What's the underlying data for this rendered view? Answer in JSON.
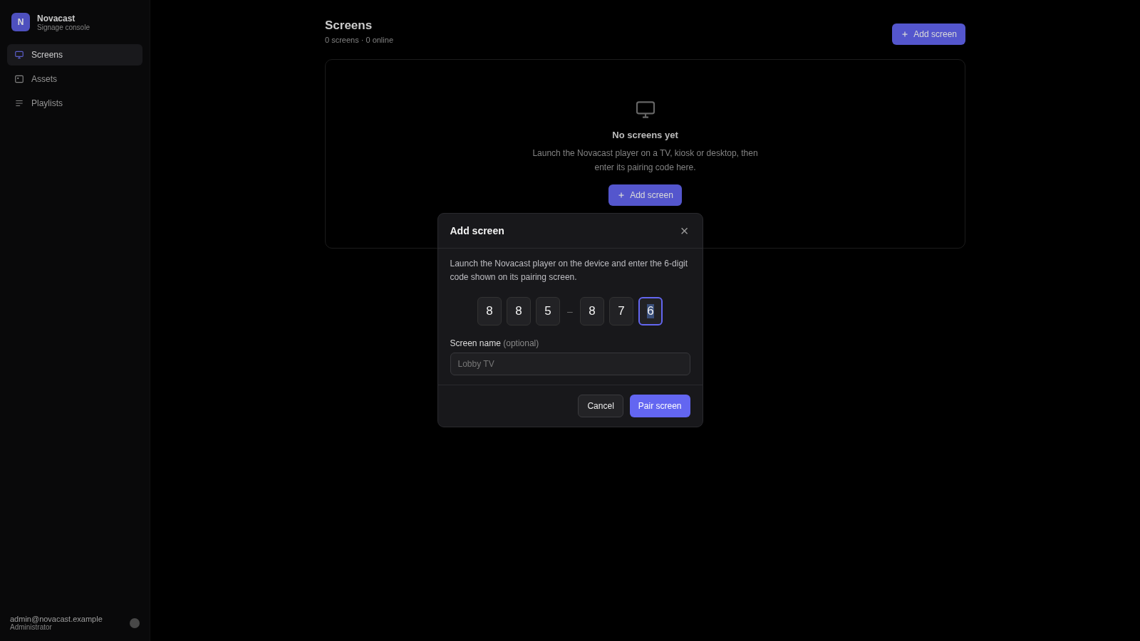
{
  "sidebar": {
    "brand": {
      "initials": "N",
      "name": "Novacast",
      "subtitle": "Signage console"
    },
    "items": [
      {
        "label": "Screens",
        "selected": true
      },
      {
        "label": "Assets",
        "selected": false
      },
      {
        "label": "Playlists",
        "selected": false
      }
    ],
    "footer": {
      "email": "admin@novacast.example",
      "role": "Administrator"
    }
  },
  "page": {
    "title": "Screens",
    "subtitle": "0 screens · 0 online",
    "add_button": "Add screen",
    "empty_state": {
      "title": "No screens yet",
      "description": "Launch the Novacast player on a TV, kiosk or desktop, then enter its pairing code here.",
      "button": "Add screen"
    }
  },
  "dialog": {
    "title": "Add screen",
    "close": "×",
    "description": "Launch the Novacast player on the device and enter the 6-digit code shown on its pairing screen.",
    "code": [
      {
        "digit": "8",
        "selected": false
      },
      {
        "digit": "8",
        "selected": false
      },
      {
        "digit": "5",
        "selected": false
      },
      {
        "digit": "8",
        "selected": false
      },
      {
        "digit": "7",
        "selected": false
      },
      {
        "digit": "6",
        "selected": true
      }
    ],
    "separator": "–",
    "name_label": "Screen name",
    "name_hint": "(optional)",
    "name_placeholder": "Lobby TV",
    "buttons": [
      {
        "label": "Cancel",
        "kind": "secondary"
      },
      {
        "label": "Pair screen",
        "kind": "primary"
      }
    ]
  }
}
